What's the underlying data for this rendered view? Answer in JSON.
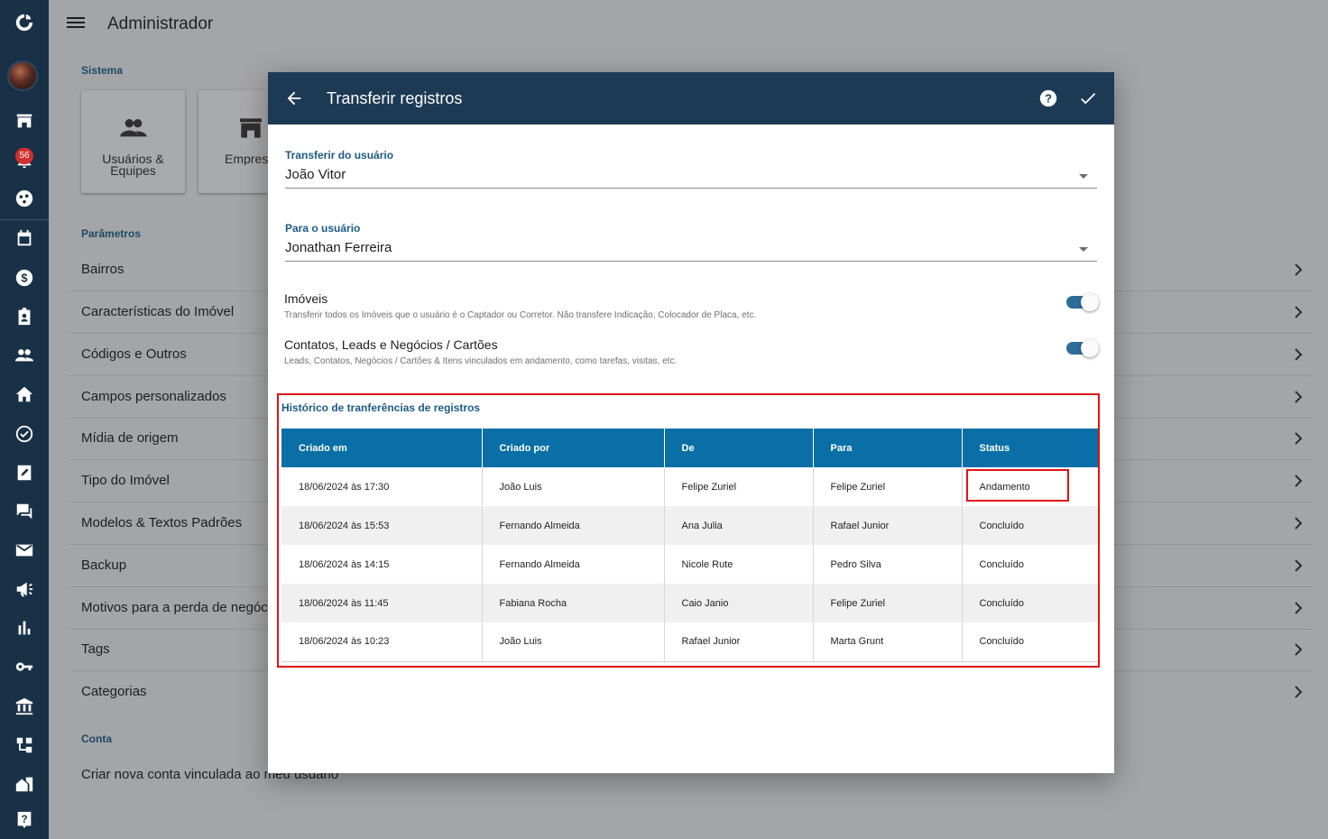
{
  "topbar": {
    "title": "Administrador"
  },
  "rail": {
    "notification_count": "56"
  },
  "sections": {
    "sistema": "Sistema",
    "parametros": "Parâmetros",
    "conta": "Conta"
  },
  "cards": [
    {
      "label": "Usuários & Equipes",
      "icon": "people-icon"
    },
    {
      "label": "Empres",
      "icon": "store-icon"
    }
  ],
  "parametros_items": [
    "Bairros",
    "Características do Imóvel",
    "Códigos e Outros",
    "Campos personalizados",
    "Mídia de origem",
    "Tipo do Imóvel",
    "Modelos & Textos Padrões",
    "Backup",
    "Motivos para a perda de negócios",
    "Tags",
    "Categorias"
  ],
  "conta_items": [
    "Criar nova conta vinculada ao meu usuário"
  ],
  "dialog": {
    "title": "Transferir registros",
    "from_field": {
      "label": "Transferir do usuário",
      "value": "João Vitor"
    },
    "to_field": {
      "label": "Para o usuário",
      "value": "Jonathan Ferreira"
    },
    "toggles": [
      {
        "title": "Imóveis",
        "description": "Transferir todos os Imóveis que o usuário é o Captador ou Corretor. Não transfere Indicação, Colocador de Placa, etc.",
        "on": true
      },
      {
        "title": "Contatos, Leads e Negócios / Cartões",
        "description": "Leads, Contatos, Negócios / Cartões & Itens vinculados em andamento, como tarefas, visitas, etc.",
        "on": true
      }
    ],
    "history": {
      "title": "Histórico de tranferências de registros",
      "columns": [
        "Criado em",
        "Criado por",
        "De",
        "Para",
        "Status"
      ],
      "rows": [
        [
          "18/06/2024 às 17:30",
          "João Luis",
          "Felipe Zuriel",
          "Felipe Zuriel",
          "Andamento"
        ],
        [
          "18/06/2024 às 15:53",
          "Fernando Almeida",
          "Ana Julia",
          "Rafael Junior",
          "Concluído"
        ],
        [
          "18/06/2024 às 14:15",
          "Fernando Almeida",
          "Nicole Rute",
          "Pedro Silva",
          "Concluído"
        ],
        [
          "18/06/2024 às 11:45",
          "Fabiana Rocha",
          "Caio Janio",
          "Felipe Zuriel",
          "Concluído"
        ],
        [
          "18/06/2024 às 10:23",
          "João Luis",
          "Rafael Junior",
          "Marta Grunt",
          "Concluído"
        ]
      ]
    }
  },
  "colors": {
    "rail": "#193146",
    "dialog_header": "#1d3a55",
    "table_header": "#0a6fa6",
    "highlight": "#e01414",
    "switch_on": "#2d6b9a"
  }
}
